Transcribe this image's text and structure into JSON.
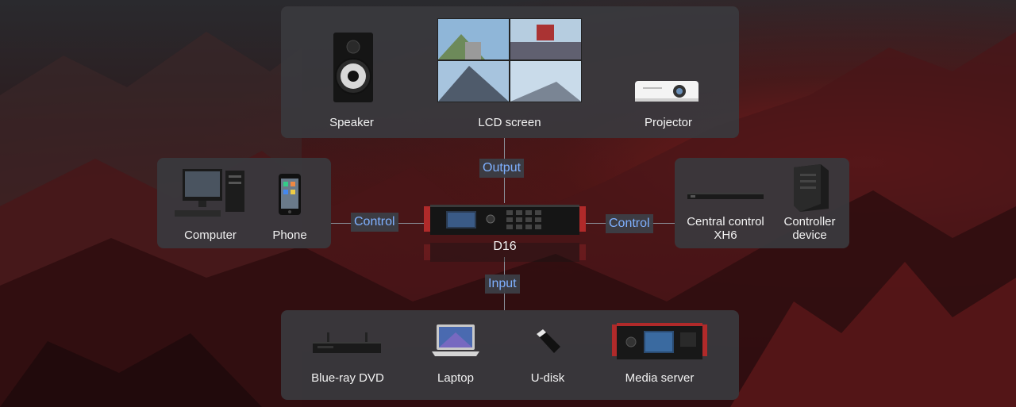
{
  "output_panel": {
    "tag": "Output",
    "devices": [
      {
        "label": "Speaker",
        "icon": "speaker-icon"
      },
      {
        "label": "LCD screen",
        "icon": "lcd-screen-icon"
      },
      {
        "label": "Projector",
        "icon": "projector-icon"
      }
    ]
  },
  "left_panel": {
    "tag": "Control",
    "devices": [
      {
        "label": "Computer",
        "icon": "computer-icon"
      },
      {
        "label": "Phone",
        "icon": "phone-icon"
      }
    ]
  },
  "right_panel": {
    "tag": "Control",
    "devices": [
      {
        "label": "Central control\nXH6",
        "icon": "central-control-icon"
      },
      {
        "label": "Controller\ndevice",
        "icon": "controller-device-icon"
      }
    ]
  },
  "center": {
    "label": "D16",
    "icon": "d16-processor-icon"
  },
  "input_panel": {
    "tag": "Input",
    "devices": [
      {
        "label": "Blue-ray DVD",
        "icon": "bluray-dvd-icon"
      },
      {
        "label": "Laptop",
        "icon": "laptop-icon"
      },
      {
        "label": "U-disk",
        "icon": "u-disk-icon"
      },
      {
        "label": "Media server",
        "icon": "media-server-icon"
      }
    ]
  },
  "colors": {
    "accent": "#7fb0ff",
    "panel": "#3a3a3e",
    "background": "#2a1a1c"
  }
}
